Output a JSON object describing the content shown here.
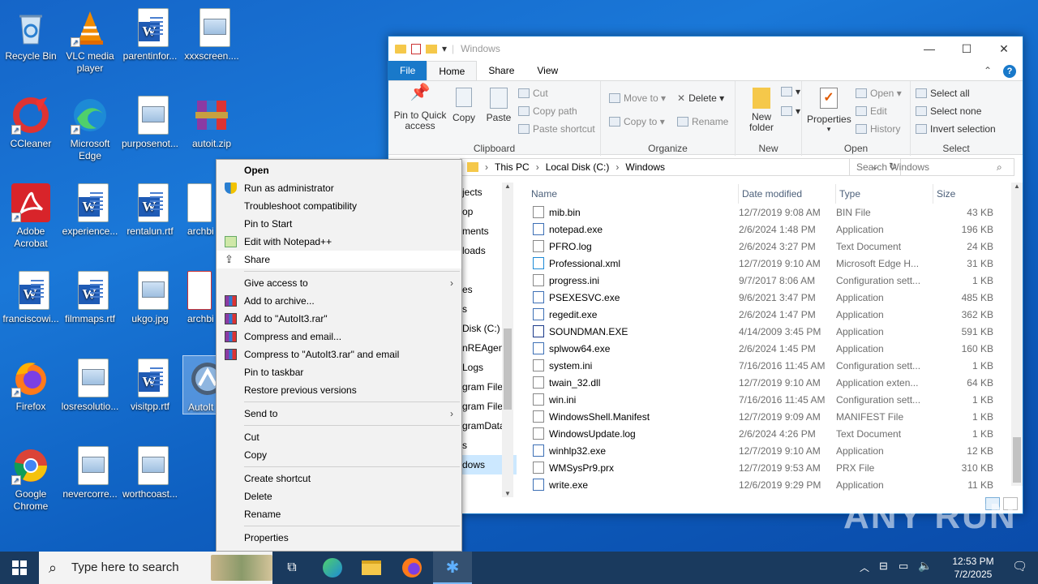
{
  "desktop": {
    "icons": [
      {
        "label": "Recycle Bin"
      },
      {
        "label": "VLC media player"
      },
      {
        "label": "parentinfor..."
      },
      {
        "label": "xxxscreen...."
      },
      {
        "label": "CCleaner"
      },
      {
        "label": "Microsoft Edge"
      },
      {
        "label": "purposenot..."
      },
      {
        "label": "autoit.zip"
      },
      {
        "label": "Adobe Acrobat"
      },
      {
        "label": "experience..."
      },
      {
        "label": "rentalun.rtf"
      },
      {
        "label": "archbi"
      },
      {
        "label": "franciscowi..."
      },
      {
        "label": "filmmaps.rtf"
      },
      {
        "label": "ukgo.jpg"
      },
      {
        "label": "archbi"
      },
      {
        "label": "Firefox"
      },
      {
        "label": "losresolutio..."
      },
      {
        "label": "visitpp.rtf"
      },
      {
        "label": "AutoIt"
      },
      {
        "label": "Google Chrome"
      },
      {
        "label": "nevercorre..."
      },
      {
        "label": "worthcoast..."
      }
    ]
  },
  "explorer": {
    "title": "Windows",
    "tabs": {
      "file": "File",
      "home": "Home",
      "share": "Share",
      "view": "View"
    },
    "ribbon": {
      "pin": "Pin to Quick access",
      "copy": "Copy",
      "paste": "Paste",
      "cut": "Cut",
      "copy_path": "Copy path",
      "paste_shortcut": "Paste shortcut",
      "clipboard": "Clipboard",
      "move_to": "Move to",
      "copy_to": "Copy to",
      "delete": "Delete",
      "rename": "Rename",
      "organize": "Organize",
      "new_folder": "New folder",
      "new": "New",
      "properties": "Properties",
      "open": "Open",
      "edit": "Edit",
      "history": "History",
      "open_group": "Open",
      "select_all": "Select all",
      "select_none": "Select none",
      "invert_selection": "Invert selection",
      "select": "Select"
    },
    "address": [
      "This PC",
      "Local Disk (C:)",
      "Windows"
    ],
    "search_placeholder": "Search Windows",
    "nav": [
      "jects",
      "op",
      "ments",
      "loads",
      "",
      "es",
      "s",
      "Disk (C:)",
      "nREAgent",
      "Logs",
      "gram Files",
      "gram Files",
      "gramData",
      "s",
      "dows"
    ],
    "columns": {
      "name": "Name",
      "date": "Date modified",
      "type": "Type",
      "size": "Size"
    },
    "files": [
      {
        "name": "mib.bin",
        "date": "12/7/2019 9:08 AM",
        "type": "BIN File",
        "size": "43 KB"
      },
      {
        "name": "notepad.exe",
        "date": "2/6/2024 1:48 PM",
        "type": "Application",
        "size": "196 KB"
      },
      {
        "name": "PFRO.log",
        "date": "2/6/2024 3:27 PM",
        "type": "Text Document",
        "size": "24 KB"
      },
      {
        "name": "Professional.xml",
        "date": "12/7/2019 9:10 AM",
        "type": "Microsoft Edge H...",
        "size": "31 KB"
      },
      {
        "name": "progress.ini",
        "date": "9/7/2017 8:06 AM",
        "type": "Configuration sett...",
        "size": "1 KB"
      },
      {
        "name": "PSEXESVC.exe",
        "date": "9/6/2021 3:47 PM",
        "type": "Application",
        "size": "485 KB"
      },
      {
        "name": "regedit.exe",
        "date": "2/6/2024 1:47 PM",
        "type": "Application",
        "size": "362 KB"
      },
      {
        "name": "SOUNDMAN.EXE",
        "date": "4/14/2009 3:45 PM",
        "type": "Application",
        "size": "591 KB"
      },
      {
        "name": "splwow64.exe",
        "date": "2/6/2024 1:45 PM",
        "type": "Application",
        "size": "160 KB"
      },
      {
        "name": "system.ini",
        "date": "7/16/2016 11:45 AM",
        "type": "Configuration sett...",
        "size": "1 KB"
      },
      {
        "name": "twain_32.dll",
        "date": "12/7/2019 9:10 AM",
        "type": "Application exten...",
        "size": "64 KB"
      },
      {
        "name": "win.ini",
        "date": "7/16/2016 11:45 AM",
        "type": "Configuration sett...",
        "size": "1 KB"
      },
      {
        "name": "WindowsShell.Manifest",
        "date": "12/7/2019 9:09 AM",
        "type": "MANIFEST File",
        "size": "1 KB"
      },
      {
        "name": "WindowsUpdate.log",
        "date": "2/6/2024 4:26 PM",
        "type": "Text Document",
        "size": "1 KB"
      },
      {
        "name": "winhlp32.exe",
        "date": "12/7/2019 9:10 AM",
        "type": "Application",
        "size": "12 KB"
      },
      {
        "name": "WMSysPr9.prx",
        "date": "12/7/2019 9:53 AM",
        "type": "PRX File",
        "size": "310 KB"
      },
      {
        "name": "write.exe",
        "date": "12/6/2019 9:29 PM",
        "type": "Application",
        "size": "11 KB"
      }
    ]
  },
  "context_menu": {
    "items": [
      "Open",
      "Run as administrator",
      "Troubleshoot compatibility",
      "Pin to Start",
      "Edit with Notepad++",
      "Share",
      "Give access to",
      "Add to archive...",
      "Add to \"AutoIt3.rar\"",
      "Compress and email...",
      "Compress to \"AutoIt3.rar\" and email",
      "Pin to taskbar",
      "Restore previous versions",
      "Send to",
      "Cut",
      "Copy",
      "Create shortcut",
      "Delete",
      "Rename",
      "Properties"
    ]
  },
  "taskbar": {
    "search_placeholder": "Type here to search",
    "time": "12:53 PM",
    "date": "7/2/2025"
  },
  "watermark": "ANY RUN"
}
